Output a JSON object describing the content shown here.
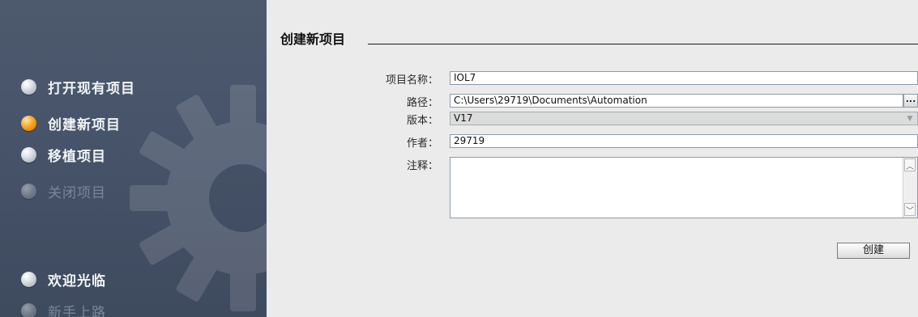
{
  "sidebar": {
    "items": [
      {
        "label": "打开现有项目",
        "state": "normal"
      },
      {
        "label": "创建新项目",
        "state": "active"
      },
      {
        "label": "移植项目",
        "state": "normal"
      },
      {
        "label": "关闭项目",
        "state": "disabled"
      },
      {
        "label": "欢迎光临",
        "state": "normal"
      },
      {
        "label": "新手上路",
        "state": "disabled"
      }
    ],
    "watermark_icon": "gear-icon",
    "colors": {
      "background": "#47546a",
      "active_bullet": "#f7a823"
    }
  },
  "form": {
    "title": "创建新项目",
    "project_name": {
      "label": "项目名称：",
      "value": "IOL7"
    },
    "path": {
      "label": "路径：",
      "value": "C:\\Users\\29719\\Documents\\Automation",
      "browse_label": "..."
    },
    "version": {
      "label": "版本：",
      "value": "V17",
      "icon": "chevron-down-icon"
    },
    "author": {
      "label": "作者：",
      "value": "29719"
    },
    "comment": {
      "label": "注释：",
      "value": ""
    },
    "create_label": "创建"
  }
}
